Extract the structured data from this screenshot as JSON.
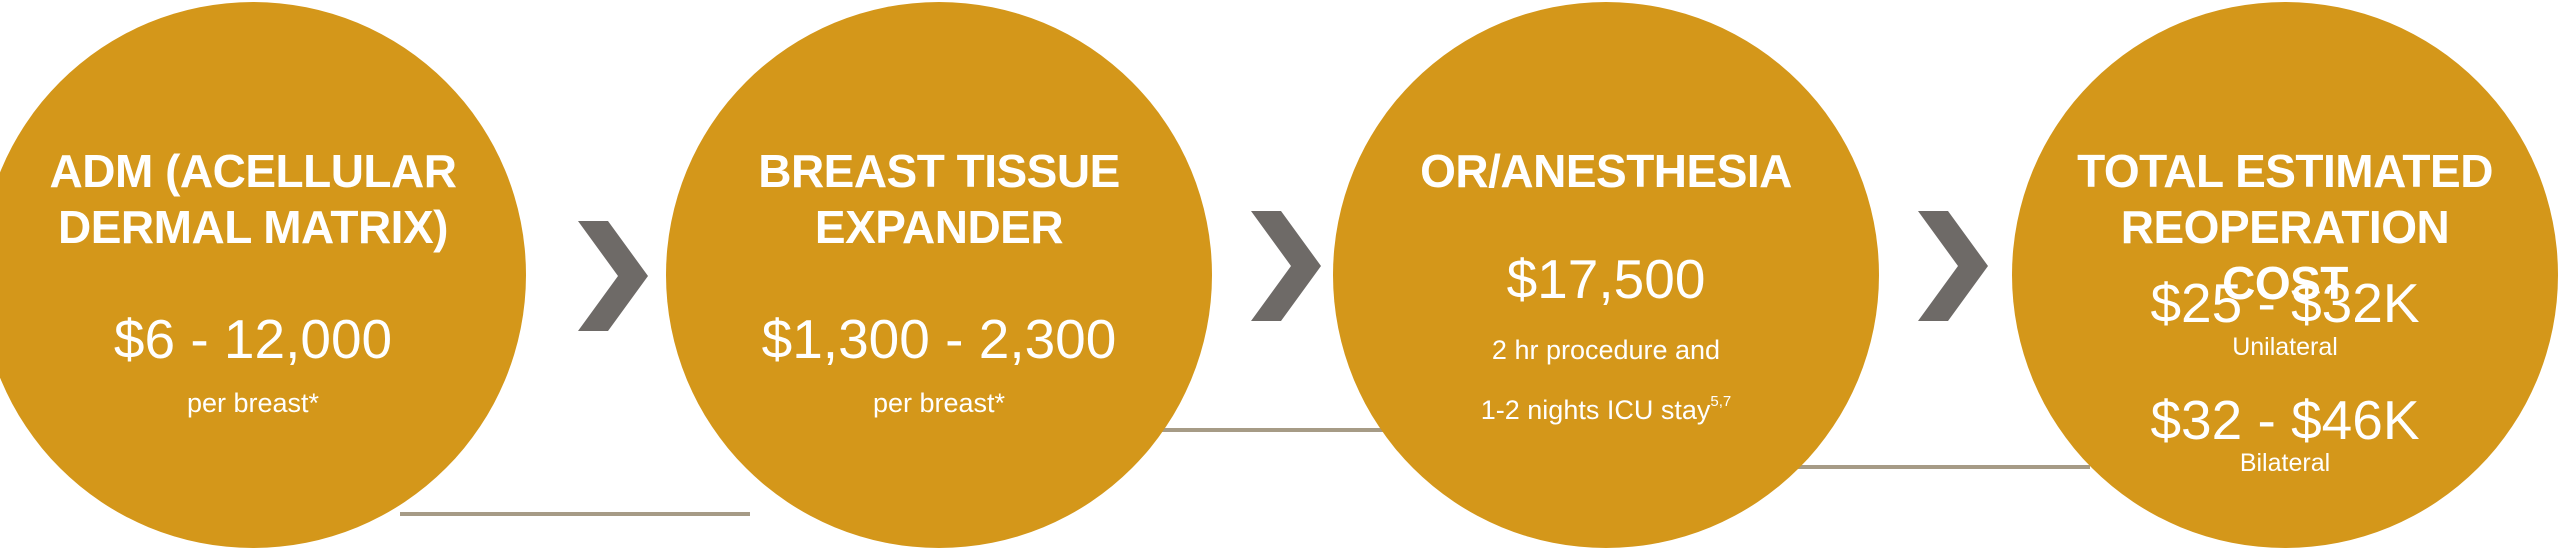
{
  "colors": {
    "circle": "#d4971a",
    "chevron": "#6e6a67",
    "connector": "#a69b86",
    "text": "#ffffff"
  },
  "steps": [
    {
      "heading_line1": "ADM (ACELLULAR",
      "heading_line2": "DERMAL MATRIX)",
      "price": "$6 - 12,000",
      "note": "per breast*"
    },
    {
      "heading_line1": "BREAST TISSUE",
      "heading_line2": "EXPANDER",
      "price": "$1,300 - 2,300",
      "note": "per breast*"
    },
    {
      "heading_line1": "OR/ANESTHESIA",
      "price": "$17,500",
      "note_line1": "2 hr procedure and",
      "note_line2": "1-2 nights ICU stay",
      "note_line2_superscript": "5,7"
    },
    {
      "heading_line1": "TOTAL ESTIMATED",
      "heading_line2": "REOPERATION COST",
      "unilateral_price": "$25 - $32K",
      "unilateral_label": "Unilateral",
      "bilateral_price": "$32 - $46K",
      "bilateral_label": "Bilateral"
    }
  ],
  "arrows": [
    "chevron-right-icon",
    "chevron-right-icon",
    "chevron-right-icon"
  ]
}
